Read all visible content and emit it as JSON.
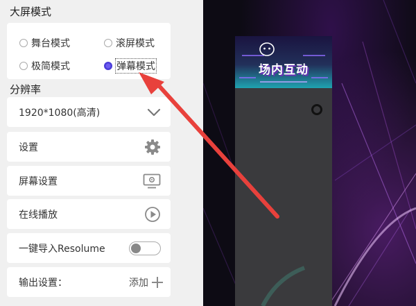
{
  "screen_mode": {
    "title": "大屏模式",
    "options": [
      {
        "label": "舞台模式",
        "selected": false
      },
      {
        "label": "滚屏模式",
        "selected": false
      },
      {
        "label": "极简模式",
        "selected": false
      },
      {
        "label": "弹幕模式",
        "selected": true
      }
    ]
  },
  "resolution": {
    "title": "分辨率",
    "value": "1920*1080(高清)"
  },
  "settings_label": "设置",
  "screen_settings_label": "屏幕设置",
  "online_play_label": "在线播放",
  "resolume": {
    "label": "一键导入Resolume",
    "enabled": false
  },
  "output": {
    "label": "输出设置：",
    "add_label": "添加"
  },
  "preview": {
    "banner_text": "场内互动"
  },
  "colors": {
    "accent": "#4a3cd8",
    "arrow": "#e8413c",
    "preview_panel": "#3a3a3d"
  }
}
